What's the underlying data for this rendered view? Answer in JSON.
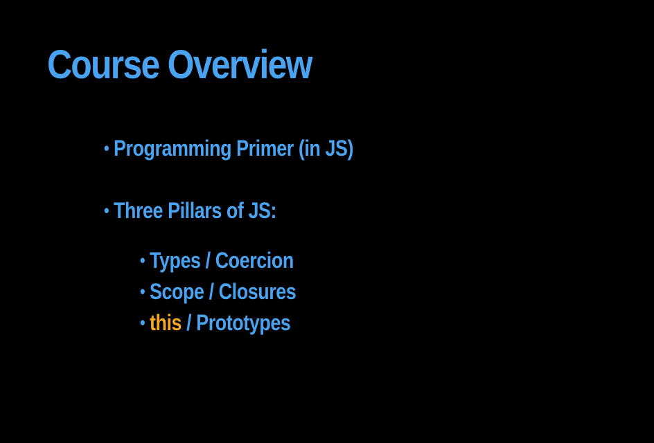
{
  "slide": {
    "title": "Course Overview",
    "bullet_glyph": "•",
    "bullets": [
      {
        "text": "Programming Primer (in JS)"
      },
      {
        "text": "Three Pillars of JS:",
        "sub": [
          {
            "text": "Types / Coercion"
          },
          {
            "text": "Scope / Closures"
          },
          {
            "highlight": "this",
            "text": " / Prototypes"
          }
        ]
      }
    ]
  },
  "colors": {
    "background": "#000000",
    "text": "#4aa3f0",
    "highlight": "#f5a623"
  }
}
